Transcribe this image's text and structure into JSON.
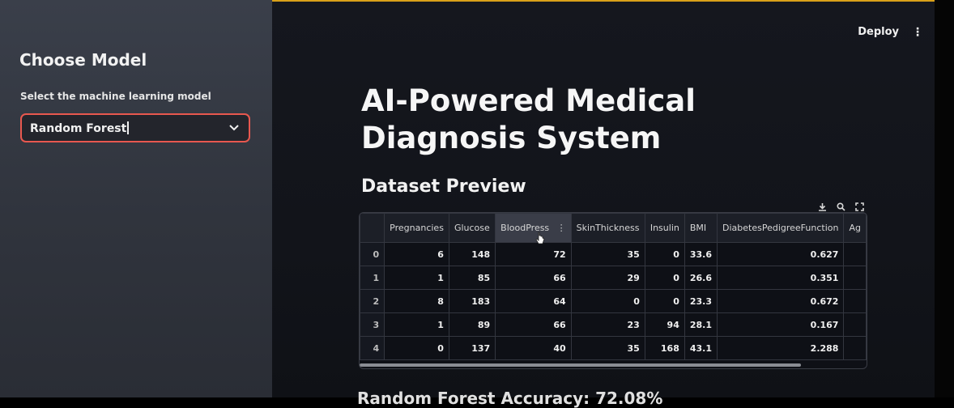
{
  "sidebar": {
    "title": "Choose Model",
    "select_label": "Select the machine learning model",
    "selected_model": "Random Forest"
  },
  "header": {
    "deploy_label": "Deploy",
    "menu_icon": "⋮"
  },
  "main": {
    "title": "AI-Powered Medical Diagnosis System",
    "dataset_heading": "Dataset Preview",
    "table": {
      "columns": [
        "",
        "Pregnancies",
        "Glucose",
        "BloodPress",
        "SkinThickness",
        "Insulin",
        "BMI",
        "DiabetesPedigreeFunction",
        "Ag"
      ],
      "rows": [
        [
          "0",
          "6",
          "148",
          "72",
          "35",
          "0",
          "33.6",
          "0.627",
          ""
        ],
        [
          "1",
          "1",
          "85",
          "66",
          "29",
          "0",
          "26.6",
          "0.351",
          ""
        ],
        [
          "2",
          "8",
          "183",
          "64",
          "0",
          "0",
          "23.3",
          "0.672",
          ""
        ],
        [
          "3",
          "1",
          "89",
          "66",
          "23",
          "94",
          "28.1",
          "0.167",
          ""
        ],
        [
          "4",
          "0",
          "137",
          "40",
          "35",
          "168",
          "43.1",
          "2.288",
          ""
        ]
      ],
      "tool_icons": [
        "download-icon",
        "search-icon",
        "fullscreen-icon"
      ]
    },
    "bottom_partial_text": "Random Forest Accuracy: 72.08%"
  },
  "colors": {
    "accent_border": "#e8584f",
    "top_bar": "#d9a019",
    "sidebar_bg": "#353943",
    "main_bg": "#14161c"
  }
}
